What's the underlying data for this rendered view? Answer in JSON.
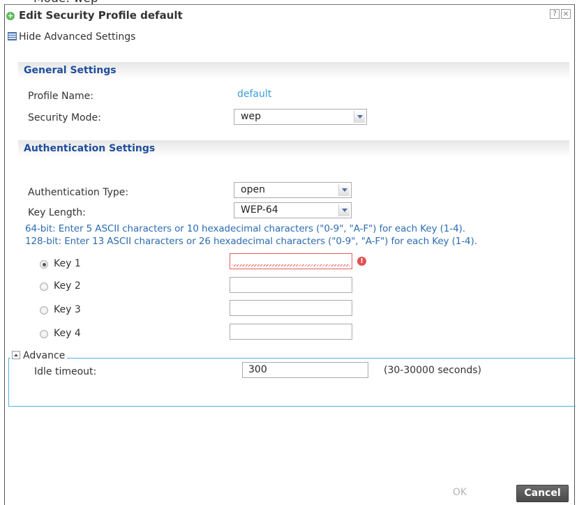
{
  "background_cut_text": "Mode: wep",
  "dialog": {
    "title": "Edit Security Profile default",
    "help_label": "?",
    "close_label": "×",
    "toggle_advanced_label": "Hide Advanced Settings"
  },
  "general": {
    "header": "General Settings",
    "profile_name_label": "Profile Name:",
    "profile_name_value": "default",
    "security_mode_label": "Security Mode:",
    "security_mode_value": "wep"
  },
  "auth": {
    "header": "Authentication Settings",
    "auth_type_label": "Authentication Type:",
    "auth_type_value": "open",
    "key_length_label": "Key Length:",
    "key_length_value": "WEP-64",
    "hint_64": "64-bit: Enter 5 ASCII characters or 10 hexadecimal characters (\"0-9\", \"A-F\") for each Key (1-4).",
    "hint_128": "128-bit: Enter 13 ASCII characters or 26 hexadecimal characters (\"0-9\", \"A-F\") for each Key (1-4).",
    "keys": [
      {
        "label": "Key 1",
        "value": "",
        "checked": true,
        "error": true
      },
      {
        "label": "Key 2",
        "value": "",
        "checked": false,
        "error": false
      },
      {
        "label": "Key 3",
        "value": "",
        "checked": false,
        "error": false
      },
      {
        "label": "Key 4",
        "value": "",
        "checked": false,
        "error": false
      }
    ],
    "error_icon_glyph": "!"
  },
  "advance": {
    "legend": "Advance",
    "idle_timeout_label": "Idle timeout:",
    "idle_timeout_value": "300",
    "idle_timeout_range": "(30-30000 seconds)"
  },
  "buttons": {
    "ok_label": "OK",
    "cancel_label": "Cancel"
  },
  "colors": {
    "section_header_text": "#1f4e9b",
    "link_value": "#3a9ad9",
    "hint_text": "#2b6cb0",
    "error": "#e05252",
    "fieldset_border": "#4fb3e5"
  }
}
